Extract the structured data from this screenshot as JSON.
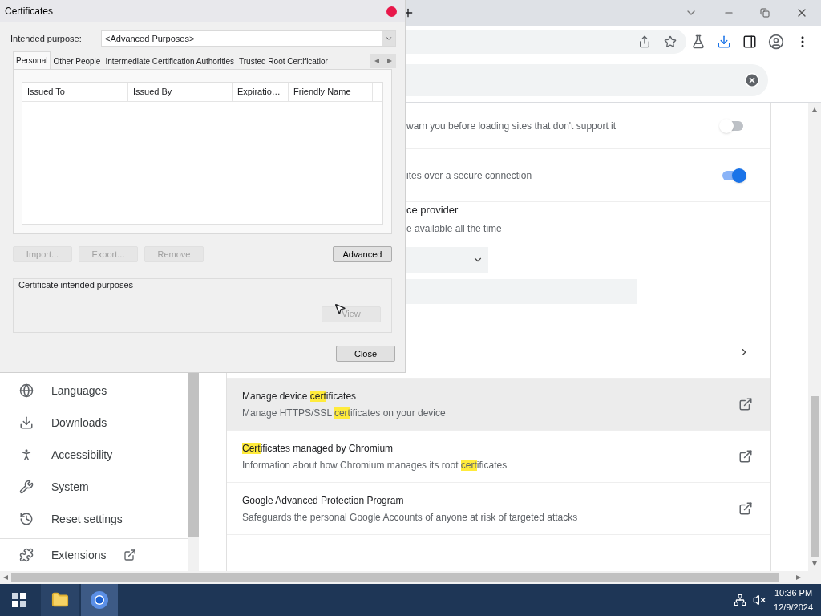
{
  "dialog": {
    "title": "Certificates",
    "purpose_label": "Intended purpose:",
    "purpose_value": "<Advanced Purposes>",
    "tabs": [
      {
        "label": "Personal",
        "selected": true
      },
      {
        "label": "Other People",
        "selected": false
      },
      {
        "label": "Intermediate Certification Authorities",
        "selected": false
      },
      {
        "label": "Trusted Root Certificatior",
        "selected": false
      }
    ],
    "columns": [
      "Issued To",
      "Issued By",
      "Expiratio…",
      "Friendly Name"
    ],
    "buttons": [
      {
        "label": "Import...",
        "disabled": true
      },
      {
        "label": "Export...",
        "disabled": true
      },
      {
        "label": "Remove",
        "disabled": true
      }
    ],
    "advanced_button": {
      "label": "Advanced",
      "disabled": false
    },
    "group_title": "Certificate intended purposes",
    "view_button": {
      "label": "View",
      "disabled": true
    },
    "close_button": {
      "label": "Close",
      "disabled": false
    }
  },
  "settings": {
    "rows": [
      {
        "kind": "toggle",
        "description": "warn you before loading sites that don't support it",
        "on": false
      },
      {
        "kind": "toggle",
        "description": "ites over a secure connection",
        "on": true
      },
      {
        "kind": "provider",
        "title": "ce provider",
        "description": "e available all the time"
      },
      {
        "kind": "submenu"
      },
      {
        "kind": "external",
        "highlighted": true,
        "title": [
          {
            "text": "Manage device "
          },
          {
            "text": "cert",
            "match": true
          },
          {
            "text": "ificates"
          }
        ],
        "description": [
          {
            "text": "Manage HTTPS/SSL "
          },
          {
            "text": "cert",
            "match": true
          },
          {
            "text": "ificates on your device"
          }
        ]
      },
      {
        "kind": "external",
        "highlighted": false,
        "title": [
          {
            "text": "Cert",
            "match": true
          },
          {
            "text": "ificates managed by Chromium"
          }
        ],
        "description": [
          {
            "text": "Information about how Chromium manages its root "
          },
          {
            "text": "cert",
            "match": true
          },
          {
            "text": "ificates"
          }
        ]
      },
      {
        "kind": "external",
        "highlighted": false,
        "title": [
          {
            "text": "Google Advanced Protection Program"
          }
        ],
        "description": [
          {
            "text": "Safeguards the personal Google Accounts of anyone at risk of targeted attacks"
          }
        ]
      }
    ],
    "sidebar": [
      {
        "kind": "link",
        "label": "Languages"
      },
      {
        "kind": "link",
        "label": "Downloads"
      },
      {
        "kind": "link",
        "label": "Accessibility"
      },
      {
        "kind": "link",
        "label": "System"
      },
      {
        "kind": "link",
        "label": "Reset settings"
      },
      {
        "kind": "external",
        "label": "Extensions"
      }
    ]
  },
  "taskbar": {
    "time": "10:36 PM",
    "date": "12/9/2024"
  }
}
